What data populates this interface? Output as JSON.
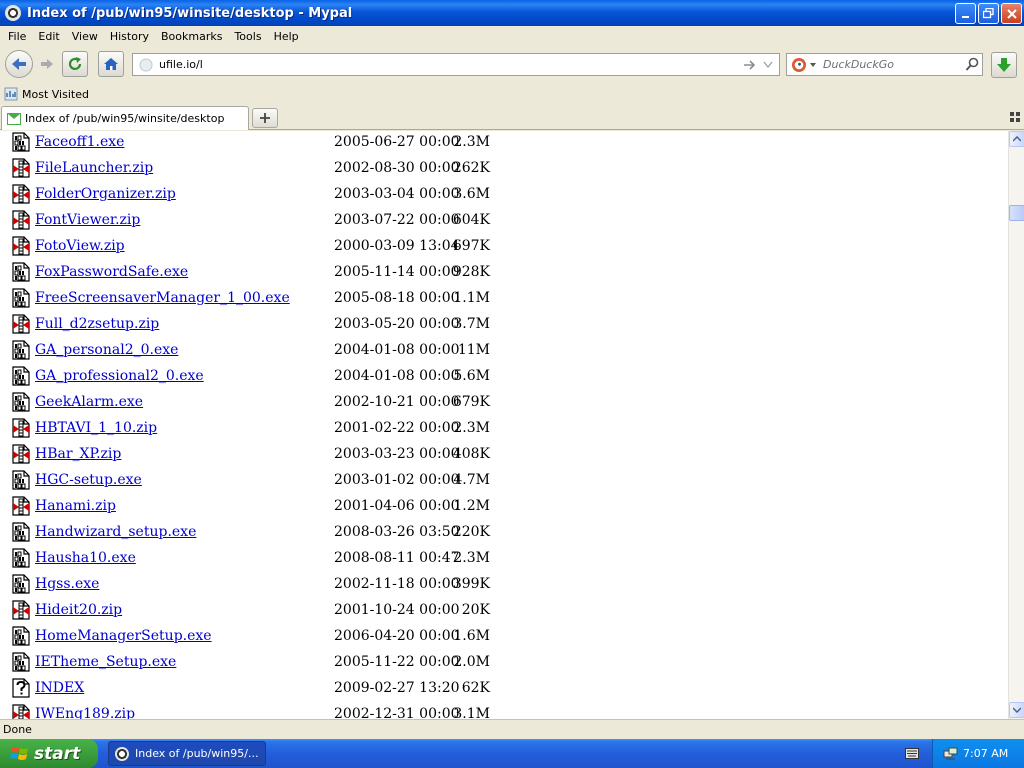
{
  "window": {
    "title": "Index of /pub/win95/winsite/desktop - Mypal"
  },
  "menu": [
    "File",
    "Edit",
    "View",
    "History",
    "Bookmarks",
    "Tools",
    "Help"
  ],
  "nav": {
    "url": "ufile.io/l",
    "search_placeholder": "DuckDuckGo"
  },
  "bookmarks": {
    "most_visited": "Most Visited"
  },
  "tab": {
    "title": "Index of /pub/win95/winsite/desktop"
  },
  "files": [
    {
      "name": "Faceoff1.exe",
      "date": "2005-06-27 00:00",
      "size": "2.3M",
      "type": "exe"
    },
    {
      "name": "FileLauncher.zip",
      "date": "2002-08-30 00:00",
      "size": "262K",
      "type": "zip"
    },
    {
      "name": "FolderOrganizer.zip",
      "date": "2003-03-04 00:00",
      "size": "3.6M",
      "type": "zip"
    },
    {
      "name": "FontViewer.zip",
      "date": "2003-07-22 00:00",
      "size": "604K",
      "type": "zip"
    },
    {
      "name": "FotoView.zip",
      "date": "2000-03-09 13:04",
      "size": "697K",
      "type": "zip"
    },
    {
      "name": "FoxPasswordSafe.exe",
      "date": "2005-11-14 00:00",
      "size": "928K",
      "type": "exe"
    },
    {
      "name": "FreeScreensaverManager_1_00.exe",
      "date": "2005-08-18 00:00",
      "size": "1.1M",
      "type": "exe"
    },
    {
      "name": "Full_d2zsetup.zip",
      "date": "2003-05-20 00:00",
      "size": "3.7M",
      "type": "zip"
    },
    {
      "name": "GA_personal2_0.exe",
      "date": "2004-01-08 00:00",
      "size": "11M",
      "type": "exe"
    },
    {
      "name": "GA_professional2_0.exe",
      "date": "2004-01-08 00:00",
      "size": "5.6M",
      "type": "exe"
    },
    {
      "name": "GeekAlarm.exe",
      "date": "2002-10-21 00:00",
      "size": "679K",
      "type": "exe"
    },
    {
      "name": "HBTAVI_1_10.zip",
      "date": "2001-02-22 00:00",
      "size": "2.3M",
      "type": "zip"
    },
    {
      "name": "HBar_XP.zip",
      "date": "2003-03-23 00:00",
      "size": "408K",
      "type": "zip"
    },
    {
      "name": "HGC-setup.exe",
      "date": "2003-01-02 00:00",
      "size": "4.7M",
      "type": "exe"
    },
    {
      "name": "Hanami.zip",
      "date": "2001-04-06 00:00",
      "size": "1.2M",
      "type": "zip"
    },
    {
      "name": "Handwizard_setup.exe",
      "date": "2008-03-26 03:50",
      "size": "220K",
      "type": "exe"
    },
    {
      "name": "Hausha10.exe",
      "date": "2008-08-11 00:47",
      "size": "2.3M",
      "type": "exe"
    },
    {
      "name": "Hgss.exe",
      "date": "2002-11-18 00:00",
      "size": "399K",
      "type": "exe"
    },
    {
      "name": "Hideit20.zip",
      "date": "2001-10-24 00:00",
      "size": "20K",
      "type": "zip"
    },
    {
      "name": "HomeManagerSetup.exe",
      "date": "2006-04-20 00:00",
      "size": "1.6M",
      "type": "exe"
    },
    {
      "name": "IETheme_Setup.exe",
      "date": "2005-11-22 00:00",
      "size": "2.0M",
      "type": "exe"
    },
    {
      "name": "INDEX",
      "date": "2009-02-27 13:20",
      "size": "62K",
      "type": "unknown"
    },
    {
      "name": "IWEng189.zip",
      "date": "2002-12-31 00:00",
      "size": "3.1M",
      "type": "zip"
    }
  ],
  "status": {
    "text": "Done"
  },
  "taskbar": {
    "start_label": "start",
    "item_label": "Index of /pub/win95/...",
    "clock": "7:07 AM"
  }
}
